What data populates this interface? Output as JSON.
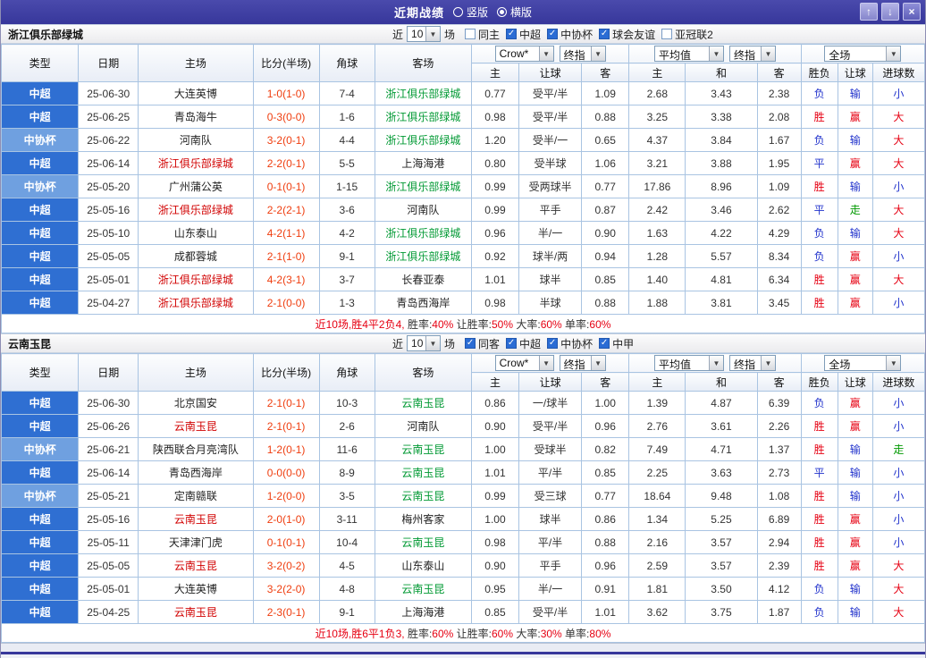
{
  "colors": {
    "titlebar_bg": "#37379b",
    "red": "#e60012",
    "blue": "#2233cc",
    "green": "#009900",
    "team_home": "#d10000",
    "team_away": "#009933",
    "score": "#ef3d0e",
    "checkbox_bg": "#2b6cd4",
    "league_bg": {
      "中超": "#2f6fd2",
      "中协杯": "#6fa0e0"
    },
    "outcome_map": {
      "胜": "red",
      "平": "blue",
      "负": "blue",
      "赢": "red",
      "输": "blue",
      "走": "green",
      "大": "red",
      "小": "blue"
    }
  },
  "titlebar": {
    "title": "近期战绩",
    "radios": [
      {
        "label": "竖版",
        "selected": false
      },
      {
        "label": "横版",
        "selected": true
      }
    ],
    "buttons": [
      {
        "name": "up",
        "glyph": "↑"
      },
      {
        "name": "down",
        "glyph": "↓"
      },
      {
        "name": "close",
        "glyph": "×"
      }
    ]
  },
  "table_headers": {
    "type": "类型",
    "date": "日期",
    "home": "主场",
    "score": "比分(半场)",
    "corner": "角球",
    "away": "客场",
    "odds": [
      "主",
      "让球",
      "客"
    ],
    "euro": [
      "主",
      "和",
      "客"
    ],
    "results": [
      "胜负",
      "让球",
      "进球数"
    ]
  },
  "sections": [
    {
      "team": "浙江俱乐部绿城",
      "filter": {
        "near": "近",
        "count": "10",
        "unit": "场",
        "checkboxes": [
          {
            "label": "同主",
            "checked": false
          },
          {
            "label": "中超",
            "checked": true
          },
          {
            "label": "中协杯",
            "checked": true
          },
          {
            "label": "球会友谊",
            "checked": true
          },
          {
            "label": "亚冠联2",
            "checked": false
          }
        ]
      },
      "selects": [
        {
          "value": "Crow*"
        },
        {
          "value": "终指"
        },
        {
          "value": "平均值"
        },
        {
          "value": "终指"
        },
        {
          "value": "全场"
        }
      ],
      "rows": [
        [
          "中超",
          "25-06-30",
          "大连英博",
          "1-0(1-0)",
          "7-4",
          "浙江俱乐部绿城",
          "0.77",
          "受平/半",
          "1.09",
          "2.68",
          "3.43",
          "2.38",
          "负",
          "输",
          "小"
        ],
        [
          "中超",
          "25-06-25",
          "青岛海牛",
          "0-3(0-0)",
          "1-6",
          "浙江俱乐部绿城",
          "0.98",
          "受平/半",
          "0.88",
          "3.25",
          "3.38",
          "2.08",
          "胜",
          "赢",
          "大"
        ],
        [
          "中协杯",
          "25-06-22",
          "河南队",
          "3-2(0-1)",
          "4-4",
          "浙江俱乐部绿城",
          "1.20",
          "受半/一",
          "0.65",
          "4.37",
          "3.84",
          "1.67",
          "负",
          "输",
          "大"
        ],
        [
          "中超",
          "25-06-14",
          "浙江俱乐部绿城",
          "2-2(0-1)",
          "5-5",
          "上海海港",
          "0.80",
          "受半球",
          "1.06",
          "3.21",
          "3.88",
          "1.95",
          "平",
          "赢",
          "大"
        ],
        [
          "中协杯",
          "25-05-20",
          "广州蒲公英",
          "0-1(0-1)",
          "1-15",
          "浙江俱乐部绿城",
          "0.99",
          "受两球半",
          "0.77",
          "17.86",
          "8.96",
          "1.09",
          "胜",
          "输",
          "小"
        ],
        [
          "中超",
          "25-05-16",
          "浙江俱乐部绿城",
          "2-2(2-1)",
          "3-6",
          "河南队",
          "0.99",
          "平手",
          "0.87",
          "2.42",
          "3.46",
          "2.62",
          "平",
          "走",
          "大"
        ],
        [
          "中超",
          "25-05-10",
          "山东泰山",
          "4-2(1-1)",
          "4-2",
          "浙江俱乐部绿城",
          "0.96",
          "半/一",
          "0.90",
          "1.63",
          "4.22",
          "4.29",
          "负",
          "输",
          "大"
        ],
        [
          "中超",
          "25-05-05",
          "成都蓉城",
          "2-1(1-0)",
          "9-1",
          "浙江俱乐部绿城",
          "0.92",
          "球半/两",
          "0.94",
          "1.28",
          "5.57",
          "8.34",
          "负",
          "赢",
          "小"
        ],
        [
          "中超",
          "25-05-01",
          "浙江俱乐部绿城",
          "4-2(3-1)",
          "3-7",
          "长春亚泰",
          "1.01",
          "球半",
          "0.85",
          "1.40",
          "4.81",
          "6.34",
          "胜",
          "赢",
          "大"
        ],
        [
          "中超",
          "25-04-27",
          "浙江俱乐部绿城",
          "2-1(0-0)",
          "1-3",
          "青岛西海岸",
          "0.98",
          "半球",
          "0.88",
          "1.88",
          "3.81",
          "3.45",
          "胜",
          "赢",
          "小"
        ]
      ],
      "summary": [
        [
          "近10场,胜4平2负4, ",
          "red"
        ],
        [
          "胜率:",
          "dark"
        ],
        [
          "40%",
          "red"
        ],
        [
          " 让胜率:",
          "dark"
        ],
        [
          "50%",
          "red"
        ],
        [
          " 大率:",
          "dark"
        ],
        [
          "60%",
          "red"
        ],
        [
          " 单率:",
          "dark"
        ],
        [
          "60%",
          "red"
        ]
      ]
    },
    {
      "team": "云南玉昆",
      "filter": {
        "near": "近",
        "count": "10",
        "unit": "场",
        "checkboxes": [
          {
            "label": "同客",
            "checked": true
          },
          {
            "label": "中超",
            "checked": true
          },
          {
            "label": "中协杯",
            "checked": true
          },
          {
            "label": "中甲",
            "checked": true
          }
        ]
      },
      "selects": [
        {
          "value": "Crow*"
        },
        {
          "value": "终指"
        },
        {
          "value": "平均值"
        },
        {
          "value": "终指"
        },
        {
          "value": "全场"
        }
      ],
      "rows": [
        [
          "中超",
          "25-06-30",
          "北京国安",
          "2-1(0-1)",
          "10-3",
          "云南玉昆",
          "0.86",
          "一/球半",
          "1.00",
          "1.39",
          "4.87",
          "6.39",
          "负",
          "赢",
          "小"
        ],
        [
          "中超",
          "25-06-26",
          "云南玉昆",
          "2-1(0-1)",
          "2-6",
          "河南队",
          "0.90",
          "受平/半",
          "0.96",
          "2.76",
          "3.61",
          "2.26",
          "胜",
          "赢",
          "小"
        ],
        [
          "中协杯",
          "25-06-21",
          "陕西联合月亮湾队",
          "1-2(0-1)",
          "11-6",
          "云南玉昆",
          "1.00",
          "受球半",
          "0.82",
          "7.49",
          "4.71",
          "1.37",
          "胜",
          "输",
          "走"
        ],
        [
          "中超",
          "25-06-14",
          "青岛西海岸",
          "0-0(0-0)",
          "8-9",
          "云南玉昆",
          "1.01",
          "平/半",
          "0.85",
          "2.25",
          "3.63",
          "2.73",
          "平",
          "输",
          "小"
        ],
        [
          "中协杯",
          "25-05-21",
          "定南赣联",
          "1-2(0-0)",
          "3-5",
          "云南玉昆",
          "0.99",
          "受三球",
          "0.77",
          "18.64",
          "9.48",
          "1.08",
          "胜",
          "输",
          "小"
        ],
        [
          "中超",
          "25-05-16",
          "云南玉昆",
          "2-0(1-0)",
          "3-11",
          "梅州客家",
          "1.00",
          "球半",
          "0.86",
          "1.34",
          "5.25",
          "6.89",
          "胜",
          "赢",
          "小"
        ],
        [
          "中超",
          "25-05-11",
          "天津津门虎",
          "0-1(0-1)",
          "10-4",
          "云南玉昆",
          "0.98",
          "平/半",
          "0.88",
          "2.16",
          "3.57",
          "2.94",
          "胜",
          "赢",
          "小"
        ],
        [
          "中超",
          "25-05-05",
          "云南玉昆",
          "3-2(0-2)",
          "4-5",
          "山东泰山",
          "0.90",
          "平手",
          "0.96",
          "2.59",
          "3.57",
          "2.39",
          "胜",
          "赢",
          "大"
        ],
        [
          "中超",
          "25-05-01",
          "大连英博",
          "3-2(2-0)",
          "4-8",
          "云南玉昆",
          "0.95",
          "半/一",
          "0.91",
          "1.81",
          "3.50",
          "4.12",
          "负",
          "输",
          "大"
        ],
        [
          "中超",
          "25-04-25",
          "云南玉昆",
          "2-3(0-1)",
          "9-1",
          "上海海港",
          "0.85",
          "受平/半",
          "1.01",
          "3.62",
          "3.75",
          "1.87",
          "负",
          "输",
          "大"
        ]
      ],
      "summary": [
        [
          "近10场,胜6平1负3, ",
          "red"
        ],
        [
          "胜率:",
          "dark"
        ],
        [
          "60%",
          "red"
        ],
        [
          " 让胜率:",
          "dark"
        ],
        [
          "60%",
          "red"
        ],
        [
          " 大率:",
          "dark"
        ],
        [
          "30%",
          "red"
        ],
        [
          " 单率:",
          "dark"
        ],
        [
          "80%",
          "red"
        ]
      ]
    }
  ]
}
